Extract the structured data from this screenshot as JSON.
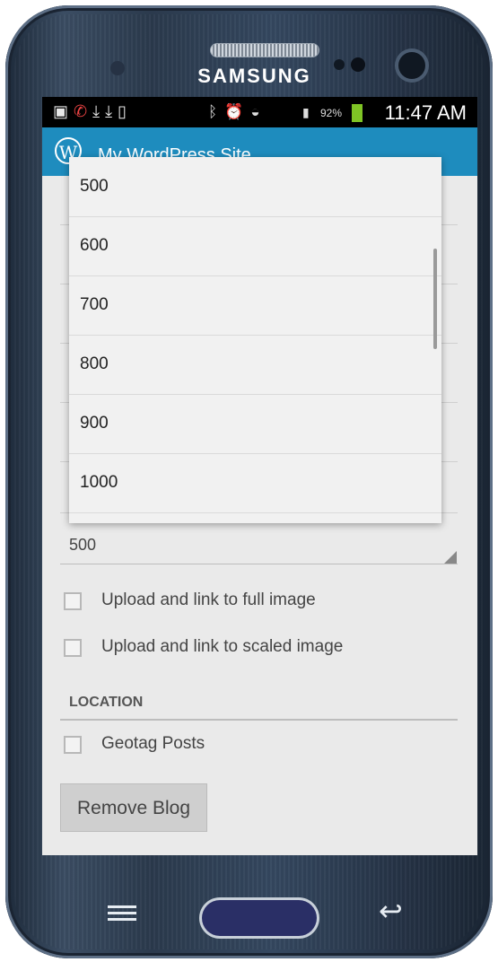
{
  "device": {
    "brand": "SAMSUNG"
  },
  "status_bar": {
    "battery": "92%",
    "time": "11:47 AM"
  },
  "action_bar": {
    "logo": "W",
    "title": "My WordPress Site"
  },
  "dropdown": {
    "options": [
      "500",
      "600",
      "700",
      "800",
      "900",
      "1000"
    ],
    "scroll_position": 0.3
  },
  "image_width_select": {
    "value": "500"
  },
  "checkboxes": [
    {
      "label": "Upload and link to full image",
      "checked": false
    },
    {
      "label": "Upload and link to scaled image",
      "checked": false
    }
  ],
  "location": {
    "heading": "LOCATION",
    "geotag": {
      "label": "Geotag Posts",
      "checked": false
    }
  },
  "remove_blog": {
    "label": "Remove Blog"
  },
  "colors": {
    "action_bar": "#1e8cbe",
    "screen_bg": "#eaeaea",
    "battery": "#7fc425"
  },
  "icons": [
    "wordpress-logo-icon",
    "menu-key-icon",
    "home-key-icon",
    "back-key-icon"
  ]
}
